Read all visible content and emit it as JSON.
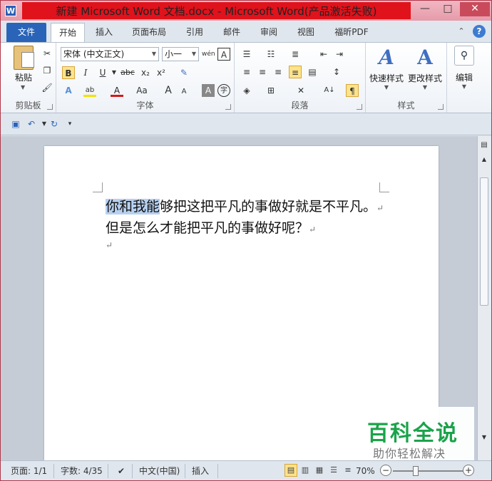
{
  "window": {
    "title": "新建 Microsoft Word 文档.docx - Microsoft Word(产品激活失败)",
    "app_icon_letter": "W",
    "minimize": "—",
    "maximize": "□",
    "close": "✕"
  },
  "tabs": [
    {
      "label": "文件"
    },
    {
      "label": "开始"
    },
    {
      "label": "插入"
    },
    {
      "label": "页面布局"
    },
    {
      "label": "引用"
    },
    {
      "label": "邮件"
    },
    {
      "label": "审阅"
    },
    {
      "label": "视图"
    },
    {
      "label": "福昕PDF"
    }
  ],
  "ribbon": {
    "clipboard": {
      "label": "剪贴板",
      "paste": "粘贴"
    },
    "font": {
      "label": "字体",
      "font_name": "宋体 (中文正文)",
      "font_size": "小一",
      "bold": "B",
      "italic": "I",
      "underline": "U",
      "strike": "abc",
      "subscript": "x₂",
      "superscript": "x²",
      "grow": "A",
      "shrink": "A",
      "change_case": "Aa",
      "char_shade": "A",
      "enclose": "字",
      "font_color": "A",
      "highlight": "ab",
      "phonetic": "wén",
      "clear_format": "A"
    },
    "paragraph": {
      "label": "段落"
    },
    "styles": {
      "label": "样式",
      "quick_styles": "快速样式",
      "change_styles": "更改样式"
    },
    "editing": {
      "label": "编辑"
    }
  },
  "document": {
    "line1_highlight": "你和我能",
    "line1_rest": "够把这把平凡的事做好就是不平凡。",
    "line2": "但是怎么才能把平凡的事做好呢？",
    "para_mark": "↵"
  },
  "watermark": {
    "main": "百科全说",
    "sub": "助你轻松解决"
  },
  "statusbar": {
    "page": "页面: 1/1",
    "words": "字数: 4/35",
    "language": "中文(中国)",
    "mode": "插入",
    "zoom": "70%",
    "zoom_minus": "−",
    "zoom_plus": "+"
  },
  "colors": {
    "title_red": "#e0121c",
    "file_tab": "#2a64b8",
    "selection": "#b7d0ef",
    "watermark_green": "#1aa34a"
  }
}
